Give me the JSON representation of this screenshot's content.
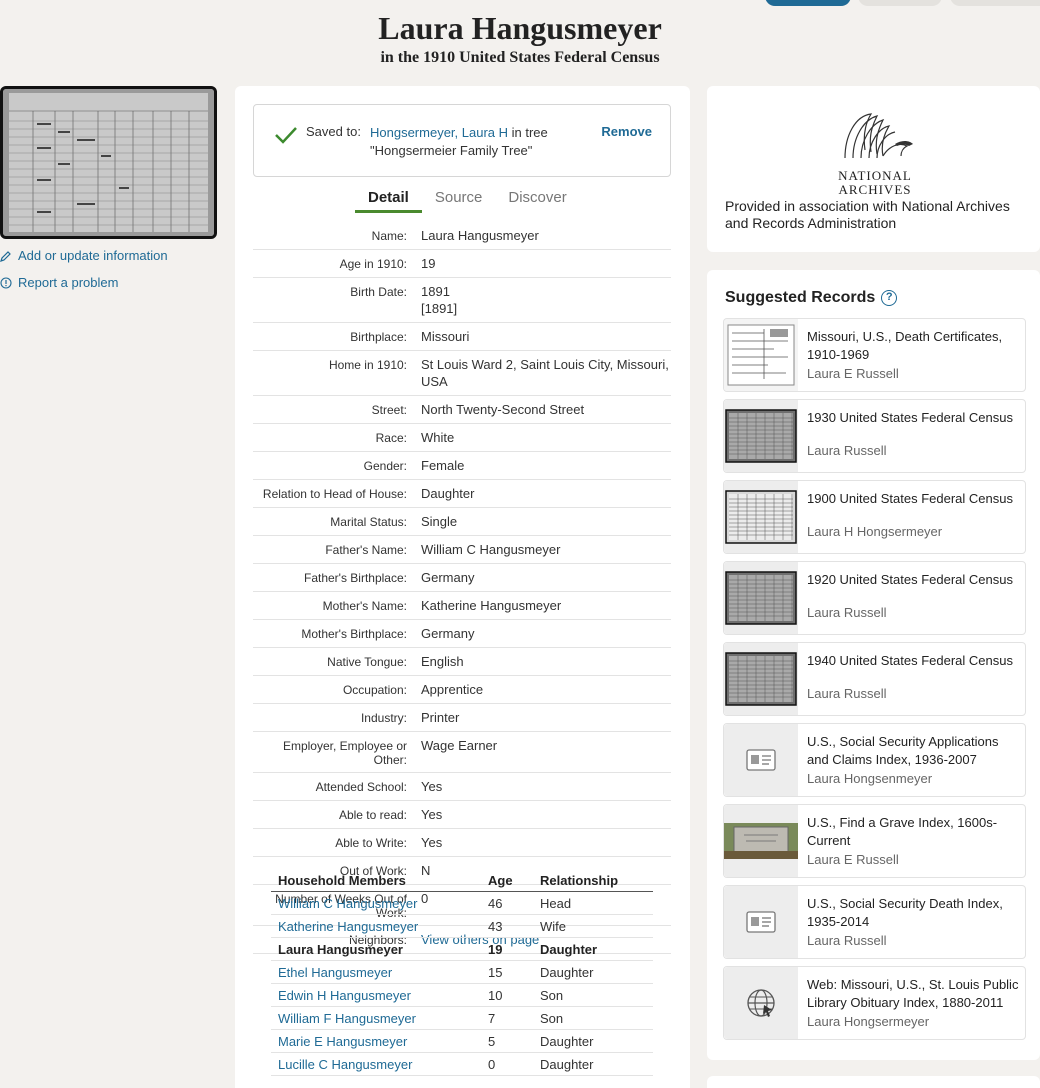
{
  "header": {
    "title": "Laura Hangusmeyer",
    "subtitle": "in the 1910 United States Federal Census"
  },
  "left": {
    "add_update_label": "Add or update information",
    "report_problem_label": "Report a problem"
  },
  "saved": {
    "label": "Saved to:",
    "person_link": "Hongsermeyer, Laura H",
    "tree_text": " in tree \"",
    "tree_name": "Hongsermeier Family Tree\"",
    "remove_label": "Remove"
  },
  "tabs": [
    {
      "label": "Detail"
    },
    {
      "label": "Source"
    },
    {
      "label": "Discover"
    }
  ],
  "details": [
    {
      "label": "Name:",
      "value": "Laura Hangusmeyer"
    },
    {
      "label": "Age in 1910:",
      "value": "19"
    },
    {
      "label": "Birth Date:",
      "value": "1891",
      "value2": "[1891]"
    },
    {
      "label": "Birthplace:",
      "value": "Missouri"
    },
    {
      "label": "Home in 1910:",
      "value": "St Louis Ward 2, Saint Louis City, Missouri, USA"
    },
    {
      "label": "Street:",
      "value": "North Twenty-Second Street"
    },
    {
      "label": "Race:",
      "value": "White"
    },
    {
      "label": "Gender:",
      "value": "Female"
    },
    {
      "label": "Relation to Head of House:",
      "value": "Daughter"
    },
    {
      "label": "Marital Status:",
      "value": "Single"
    },
    {
      "label": "Father's Name:",
      "value": "William C Hangusmeyer"
    },
    {
      "label": "Father's Birthplace:",
      "value": "Germany"
    },
    {
      "label": "Mother's Name:",
      "value": "Katherine Hangusmeyer"
    },
    {
      "label": "Mother's Birthplace:",
      "value": "Germany"
    },
    {
      "label": "Native Tongue:",
      "value": "English"
    },
    {
      "label": "Occupation:",
      "value": "Apprentice"
    },
    {
      "label": "Industry:",
      "value": "Printer"
    },
    {
      "label": "Employer, Employee or Other:",
      "value": "Wage Earner"
    },
    {
      "label": "Attended School:",
      "value": "Yes"
    },
    {
      "label": "Able to read:",
      "value": "Yes"
    },
    {
      "label": "Able to Write:",
      "value": "Yes"
    },
    {
      "label": "Out of Work:",
      "value": "N"
    },
    {
      "label": "Number of Weeks Out of Work:",
      "value": "0"
    },
    {
      "label": "Neighbors:",
      "value": "View others on page",
      "link": true
    }
  ],
  "household": {
    "headers": {
      "name": "Household Members",
      "age": "Age",
      "relationship": "Relationship"
    },
    "members": [
      {
        "name": "William C Hangusmeyer",
        "age": "46",
        "relationship": "Head"
      },
      {
        "name": "Katherine Hangusmeyer",
        "age": "43",
        "relationship": "Wife"
      },
      {
        "name": "Laura Hangusmeyer",
        "age": "19",
        "relationship": "Daughter",
        "self": true
      },
      {
        "name": "Ethel Hangusmeyer",
        "age": "15",
        "relationship": "Daughter"
      },
      {
        "name": "Edwin H Hangusmeyer",
        "age": "10",
        "relationship": "Son"
      },
      {
        "name": "William F Hangusmeyer",
        "age": "7",
        "relationship": "Son"
      },
      {
        "name": "Marie E Hangusmeyer",
        "age": "5",
        "relationship": "Daughter"
      },
      {
        "name": "Lucille C Hangusmeyer",
        "age": "0",
        "relationship": "Daughter"
      }
    ]
  },
  "nara": {
    "logo_line1": "NATIONAL",
    "logo_line2": "ARCHIVES",
    "text": "Provided in association with National Archives and Records Administration"
  },
  "suggested": {
    "title": "Suggested Records",
    "help_icon": "?",
    "records": [
      {
        "title": "Missouri, U.S., Death Certificates, 1910-1969",
        "name": "Laura E Russell",
        "thumb": "document"
      },
      {
        "title": "1930 United States Federal Census",
        "name": "Laura Russell",
        "thumb": "census-dark"
      },
      {
        "title": "1900 United States Federal Census",
        "name": "Laura H Hongsermeyer",
        "thumb": "census-light"
      },
      {
        "title": "1920 United States Federal Census",
        "name": "Laura Russell",
        "thumb": "census-dark"
      },
      {
        "title": "1940 United States Federal Census",
        "name": "Laura Russell",
        "thumb": "census-dark"
      },
      {
        "title": "U.S., Social Security Applications and Claims Index, 1936-2007",
        "name": "Laura Hongsenmeyer",
        "thumb": "card-icon"
      },
      {
        "title": "U.S., Find a Grave Index, 1600s-Current",
        "name": "Laura E Russell",
        "thumb": "gravestone"
      },
      {
        "title": "U.S., Social Security Death Index, 1935-2014",
        "name": "Laura Russell",
        "thumb": "card-icon"
      },
      {
        "title": "Web: Missouri, U.S., St. Louis Public Library Obituary Index, 1880-2011",
        "name": "Laura Hongsermeyer",
        "thumb": "globe-icon"
      }
    ]
  }
}
